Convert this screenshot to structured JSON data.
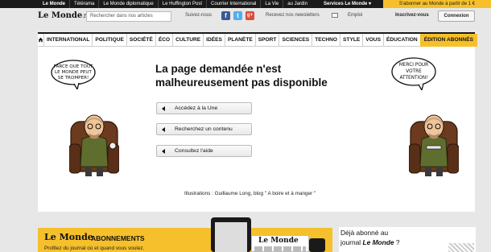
{
  "topbar": {
    "links": [
      "Le Monde",
      "Télérama",
      "Le Monde diplomatique",
      "Le Huffington Post",
      "Courrier International",
      "La Vie",
      "au Jardin"
    ],
    "services": "Services Le Monde ▾",
    "subscribe": "S'abonner au Monde à partir de 1 €"
  },
  "header": {
    "logo": "Le Monde",
    "logo_suffix": ".fr",
    "search_placeholder": "Rechercher dans nos articles",
    "follow": "Suivez-nous",
    "newsletter": "Recevez nos newsletters",
    "emploi": "Emploi",
    "register": "Inscrivez-vous",
    "login": "Connexion"
  },
  "nav": {
    "items": [
      "INTERNATIONAL",
      "POLITIQUE",
      "SOCIÉTÉ",
      "ÉCO",
      "CULTURE",
      "IDÉES",
      "PLANÈTE",
      "SPORT",
      "SCIENCES",
      "TECHNO",
      "STYLE",
      "VOUS",
      "ÉDUCATION"
    ],
    "abonnes": "ÉDITION ABONNÉS"
  },
  "error": {
    "title": "La page demandée n'est malheureusement pas disponible",
    "buttons": [
      "Accédez à la Une",
      "Recherchez un contenu",
      "Consultez l'aide"
    ]
  },
  "illustrations": {
    "bubble_left": [
      "PARCE QUE TOUT",
      "LE MONDE PEUT",
      "SE TROMPER!"
    ],
    "bubble_right": [
      "MERCI POUR",
      "VOTRE",
      "ATTENTION!"
    ],
    "credit": "Illustrations : Guillaume Long, blog \" A boire et à manger \""
  },
  "promo": {
    "brand": "Le Monde",
    "title": "ABONNEMENTS",
    "subtitle": "Profitez du journal où et quand vous voulez.",
    "paper_logo": "Le Monde"
  },
  "already": {
    "line1": "Déjà abonné au",
    "line2_prefix": "journal ",
    "line2_brand": "Le Monde",
    "line2_suffix": " ?"
  }
}
